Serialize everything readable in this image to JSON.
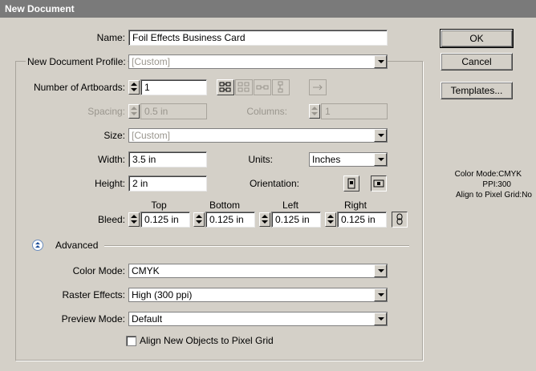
{
  "window": {
    "title": "New Document"
  },
  "name": {
    "label": "Name:",
    "value": "Foil Effects Business Card"
  },
  "profile": {
    "label": "New Document Profile:",
    "value": "[Custom]"
  },
  "artboards": {
    "label": "Number of Artboards:",
    "value": "1"
  },
  "spacing": {
    "label": "Spacing:",
    "value": "0.5 in"
  },
  "columns": {
    "label": "Columns:",
    "value": "1"
  },
  "size": {
    "label": "Size:",
    "value": "[Custom]"
  },
  "width": {
    "label": "Width:",
    "value": "3.5 in"
  },
  "units": {
    "label": "Units:",
    "value": "Inches"
  },
  "height": {
    "label": "Height:",
    "value": "2 in"
  },
  "orientation": {
    "label": "Orientation:"
  },
  "bleed": {
    "label": "Bleed:",
    "top_label": "Top",
    "bottom_label": "Bottom",
    "left_label": "Left",
    "right_label": "Right",
    "top": "0.125 in",
    "bottom": "0.125 in",
    "left": "0.125 in",
    "right": "0.125 in"
  },
  "advanced": {
    "label": "Advanced"
  },
  "color_mode": {
    "label": "Color Mode:",
    "value": "CMYK"
  },
  "raster_effects": {
    "label": "Raster Effects:",
    "value": "High (300 ppi)"
  },
  "preview_mode": {
    "label": "Preview Mode:",
    "value": "Default"
  },
  "align_pixel": {
    "label": "Align New Objects to Pixel Grid",
    "checked": false
  },
  "buttons": {
    "ok": "OK",
    "cancel": "Cancel",
    "templates": "Templates..."
  },
  "info": {
    "line1": "Color Mode:CMYK",
    "line2": "PPI:300",
    "line3": "Align to Pixel Grid:No"
  },
  "icons": [
    "grid-by-row-icon",
    "grid-by-column-icon",
    "arrange-by-row-icon",
    "arrange-by-column-icon",
    "right-to-left-icon",
    "portrait-icon",
    "landscape-icon",
    "link-icon",
    "collapse-advanced-icon"
  ]
}
